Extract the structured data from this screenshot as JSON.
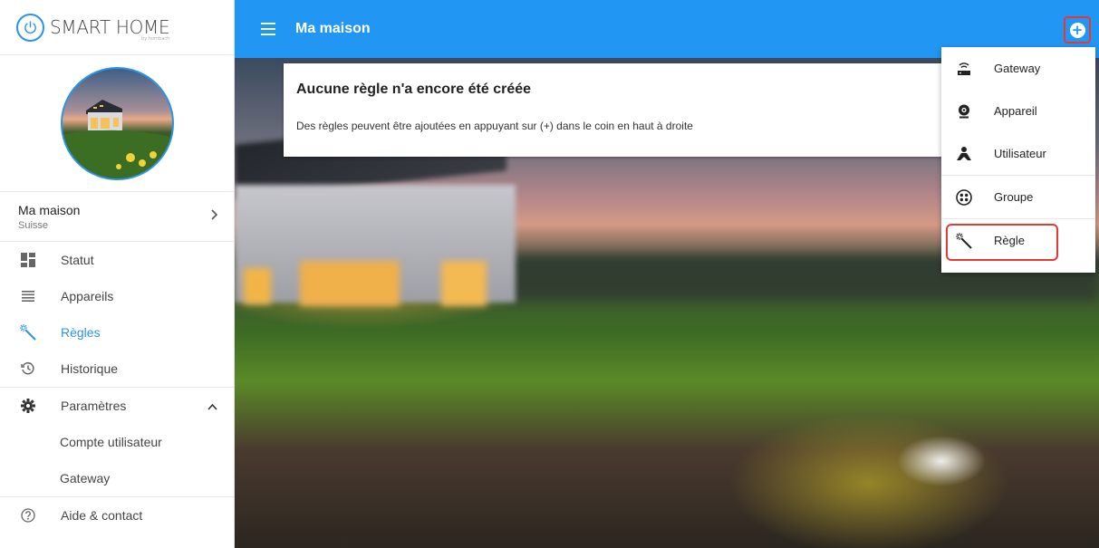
{
  "logo": {
    "brand": "SMART HOME",
    "sub": "by hornbach"
  },
  "place": {
    "name": "Ma maison",
    "country": "Suisse"
  },
  "nav": {
    "statut": "Statut",
    "appareils": "Appareils",
    "regles": "Règles",
    "historique": "Historique",
    "parametres": "Paramètres",
    "compte": "Compte utilisateur",
    "gateway": "Gateway",
    "aide": "Aide & contact"
  },
  "topbar": {
    "title": "Ma maison"
  },
  "card": {
    "title": "Aucune règle n'a encore été créée",
    "body": "Des règles peuvent être ajoutées en appuyant sur (+) dans le coin en haut à droite"
  },
  "dropdown": {
    "items": [
      {
        "label": "Gateway",
        "icon": "router-icon"
      },
      {
        "label": "Appareil",
        "icon": "webcam-icon"
      },
      {
        "label": "Utilisateur",
        "icon": "user-icon"
      },
      {
        "label": "Groupe",
        "icon": "group-icon"
      },
      {
        "label": "Règle",
        "icon": "magic-wand-icon"
      }
    ]
  },
  "colors": {
    "primary": "#2196f3",
    "highlight": "#e53935"
  }
}
